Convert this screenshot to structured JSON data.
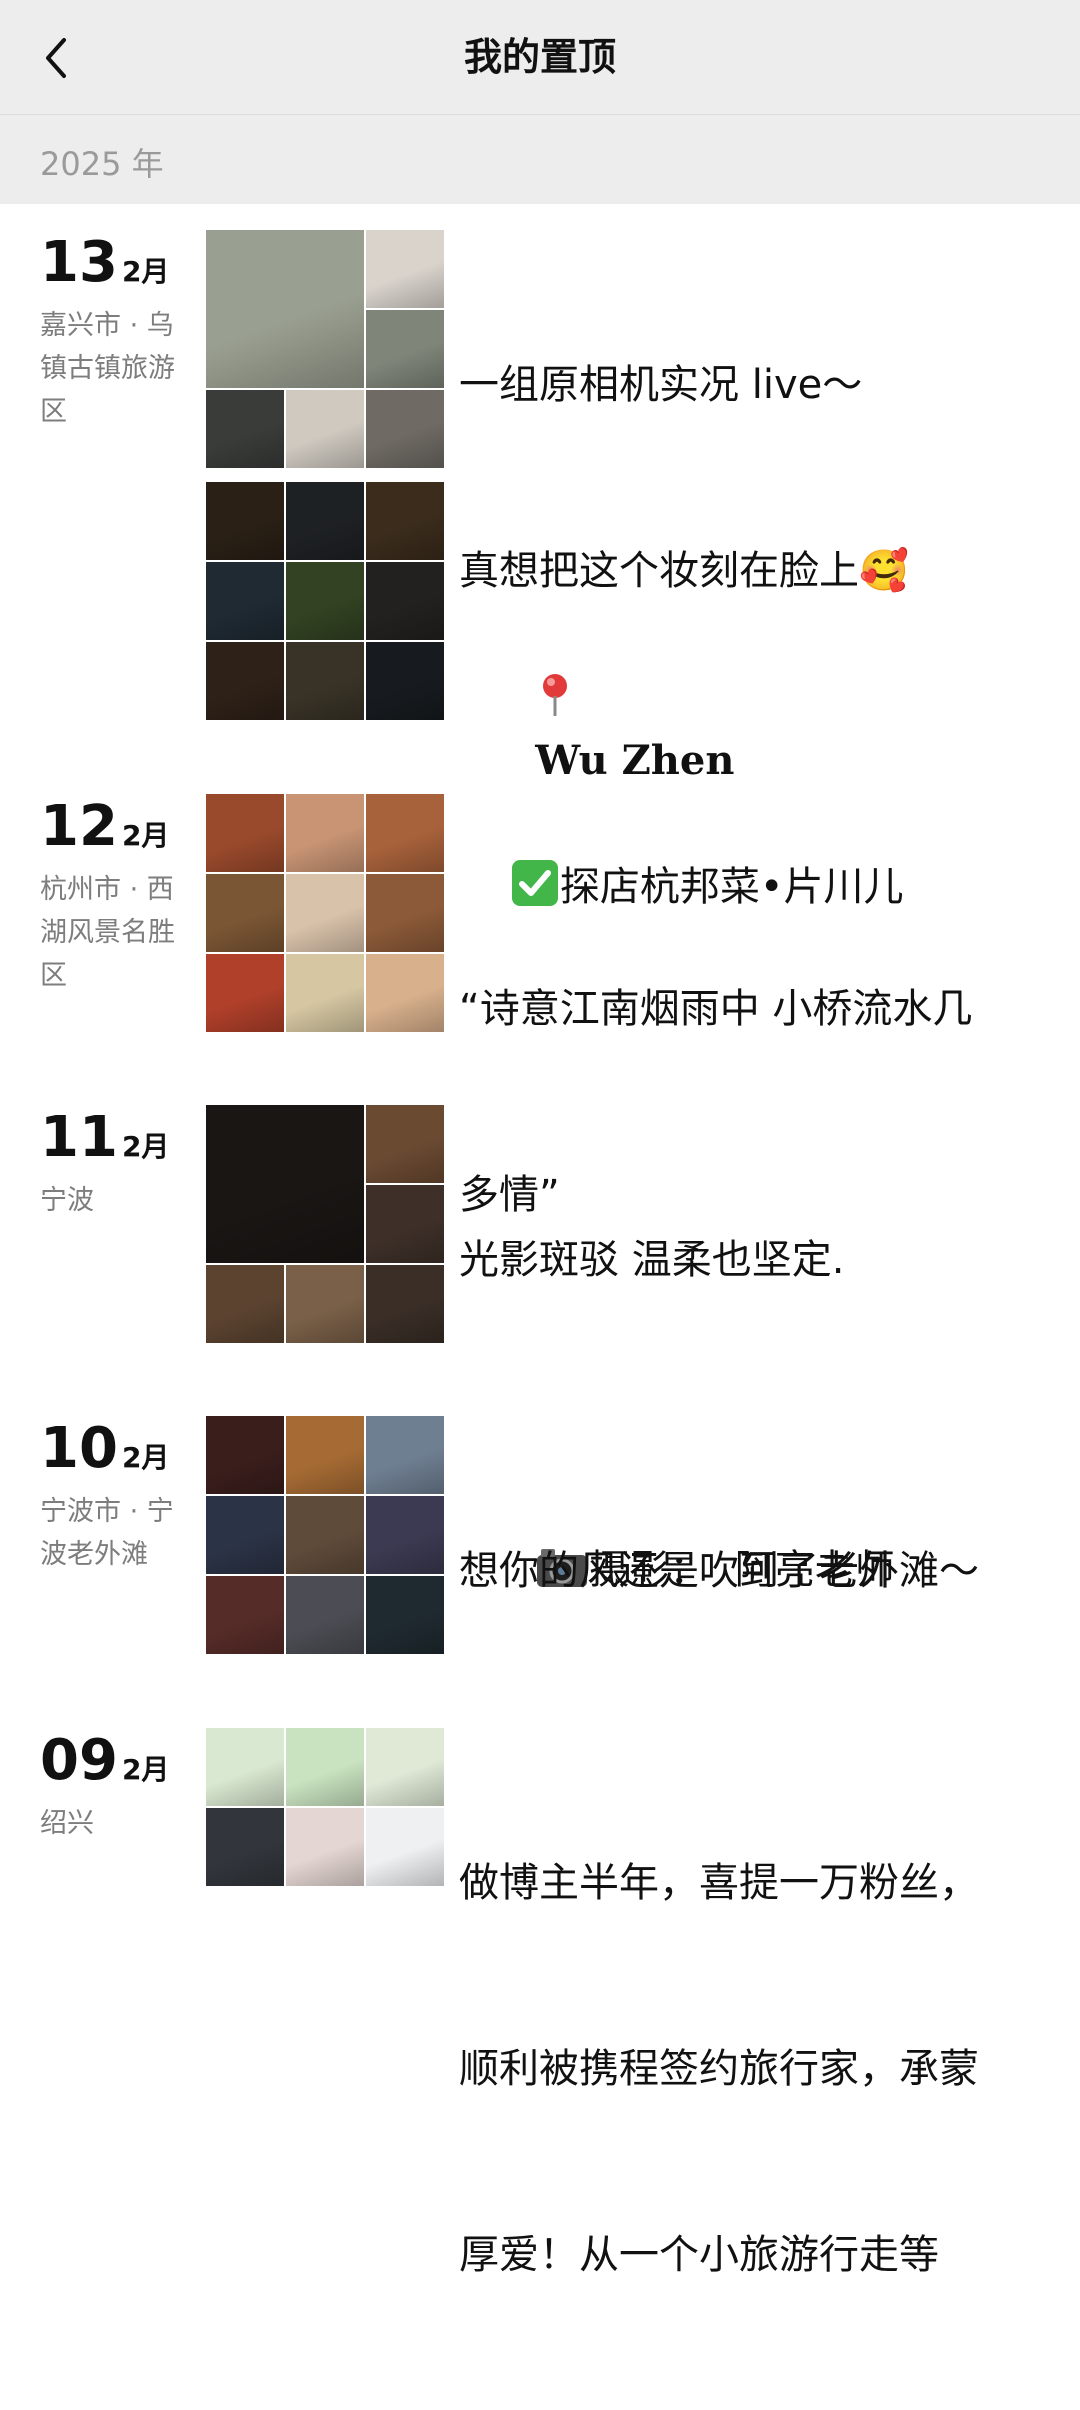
{
  "header": {
    "title": "我的置顶",
    "back_icon": "chevron-left-icon"
  },
  "year_label": "2025 年",
  "posts": [
    {
      "day": "13",
      "month": "2月",
      "location": "嘉兴市 · 乌镇古镇旅游区",
      "caption_line1": "一组原相机实况 live～",
      "caption_line2": "真想把这个妆刻在脸上",
      "caption_emoji": "🥰",
      "grid1_colors": [
        "#9aa091",
        "#d9d3cc",
        "#7f8579",
        "#3a3c3a",
        "#cfc9c0",
        "#6f6a64"
      ],
      "grid2_colors": [
        "#2a2016",
        "#1e2124",
        "#3b2c1c",
        "#1f2a33",
        "#324222",
        "#22211f",
        "#2e2118",
        "#393327",
        "#171b1f"
      ],
      "pin_icon": "pin-icon",
      "place": "Wu Zhen",
      "quote_line1": "“诗意江南烟雨中 小桥流水几",
      "quote_line2": "多情”"
    },
    {
      "day": "12",
      "month": "2月",
      "location": "杭州市 · 西湖风景名胜区",
      "check_icon": "check-icon",
      "caption": "探店杭邦菜•片川儿",
      "grid_colors": [
        "#9a4a2c",
        "#c89474",
        "#a8623b",
        "#7b5634",
        "#d9c2aa",
        "#8c5a38",
        "#b0402a",
        "#d6c7a2",
        "#d8b08c"
      ]
    },
    {
      "day": "11",
      "month": "2月",
      "location": "宁波",
      "caption_line1": "光影斑驳 温柔也坚定.",
      "camera_icon": "camera-icon",
      "caption_line2": "摄影：  阿亮老师",
      "grid_colors": [
        "#1a1614",
        "#6b4a32",
        "#3e3029",
        "#5b4330",
        "#7a6048",
        "#3a2e27"
      ]
    },
    {
      "day": "10",
      "month": "2月",
      "location": "宁波市 · 宁波老外滩",
      "caption": "想你的风还是吹到了老外滩～",
      "grid_colors": [
        "#3a1e1c",
        "#a66b34",
        "#6f7f92",
        "#2b3346",
        "#5f4b3a",
        "#3b3a52",
        "#562c28",
        "#4c4d54",
        "#1f2a30"
      ]
    },
    {
      "day": "09",
      "month": "2月",
      "location": "绍兴",
      "caption_line1": "做博主半年，喜提一万粉丝，",
      "caption_line2": "顺利被携程签约旅行家，承蒙",
      "caption_line3": "厚爱！从一个小旅游行走等",
      "grid_colors": [
        "#d9e8d0",
        "#c9e3c0",
        "#dfe9d6",
        "#32363c",
        "#e4d6d2",
        "#eef0f2"
      ]
    }
  ]
}
